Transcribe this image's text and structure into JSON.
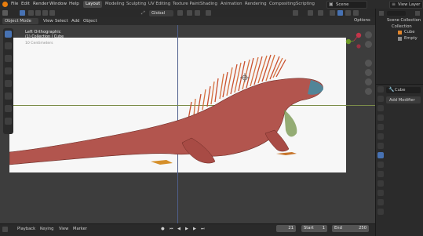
{
  "topbar": {
    "menus": [
      "File",
      "Edit",
      "Render",
      "Window",
      "Help"
    ],
    "workspaces": [
      "Layout",
      "Modeling",
      "Sculpting",
      "UV Editing",
      "Texture Paint",
      "Shading",
      "Animation",
      "Rendering",
      "Compositing",
      "Scripting"
    ],
    "active_workspace": "Layout",
    "scene_label": "Scene",
    "view_layer_label": "View Layer"
  },
  "viewport_header": {
    "transform_orientation": "Global",
    "options_label": "Options"
  },
  "viewport_header2": {
    "mode": "Object Mode",
    "menus": [
      "View",
      "Select",
      "Add",
      "Object"
    ]
  },
  "viewport": {
    "view_name": "Left Orthographic",
    "collection_line": "(1) Collection | Cube",
    "scale_text": "10 Centimeters"
  },
  "outliner": {
    "root": "Scene Collection",
    "collection": "Collection",
    "items": [
      "Cube",
      "Empty"
    ]
  },
  "properties": {
    "object_name": "Cube",
    "add_modifier_label": "Add Modifier"
  },
  "timeline": {
    "menus": [
      "Playback",
      "Keying",
      "View",
      "Marker"
    ],
    "current_frame": "21",
    "start_label": "Start",
    "start_value": "1",
    "end_label": "End",
    "end_value": "250"
  },
  "colors": {
    "accent": "#4772b3",
    "blender_orange": "#e87d0d",
    "lizard_body": "#b2554e"
  }
}
